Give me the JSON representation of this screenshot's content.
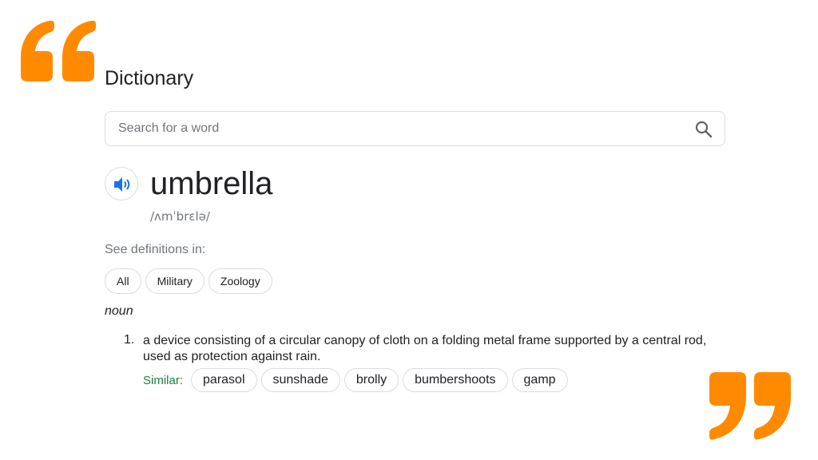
{
  "colors": {
    "quote_accent": "#ff8a00",
    "speaker_blue": "#1a73e8",
    "similar_green": "#188038",
    "border_gray": "#dadce0"
  },
  "dictionary": {
    "title": "Dictionary",
    "search": {
      "placeholder": "Search for a word",
      "value": "",
      "icon": "search-icon"
    },
    "entry": {
      "speaker_icon": "speaker-icon",
      "headword": "umbrella",
      "phonetic": "/ʌmˈbrɛlə/",
      "see_definitions_label": "See definitions in:",
      "categories": [
        "All",
        "Military",
        "Zoology"
      ],
      "part_of_speech": "noun",
      "definitions": [
        {
          "number": "1.",
          "text": "a device consisting of a circular canopy of cloth on a folding metal frame supported by a central rod, used as protection against rain.",
          "similar_label": "Similar:",
          "similar": [
            "parasol",
            "sunshade",
            "brolly",
            "bumbershoots",
            "gamp"
          ]
        }
      ]
    }
  }
}
